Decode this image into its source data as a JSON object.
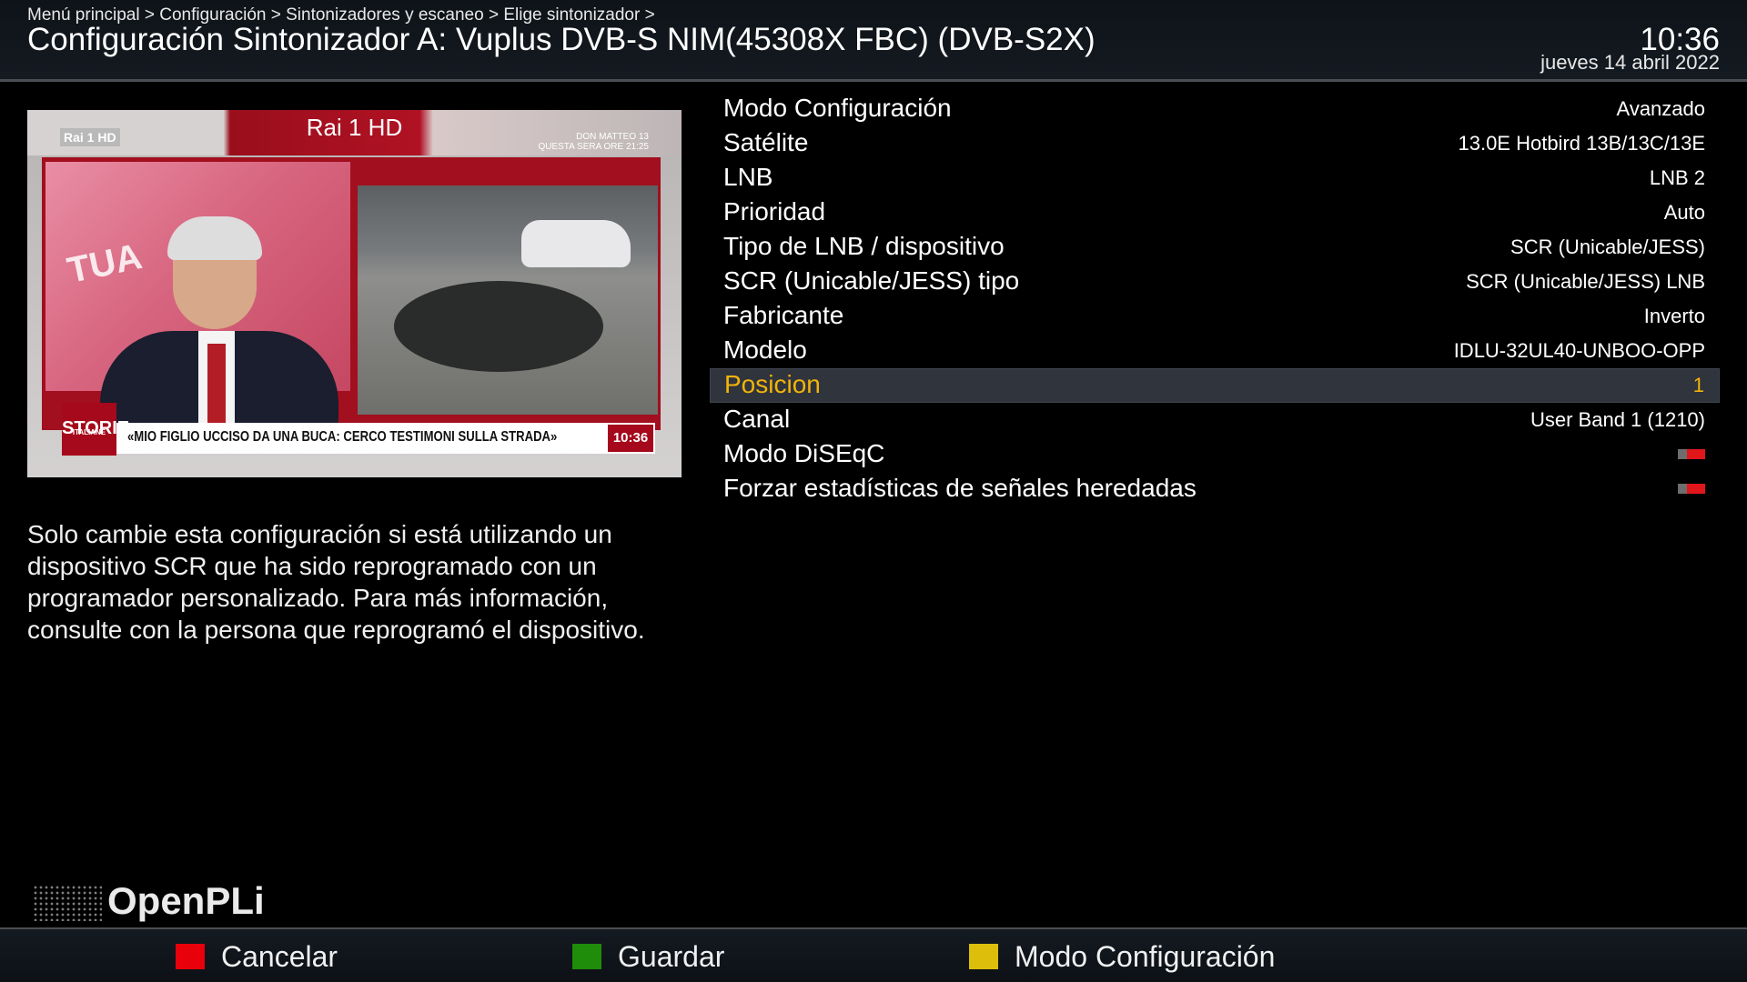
{
  "header": {
    "breadcrumb": "Menú principal > Configuración > Sintonizadores y escaneo > Elige sintonizador >",
    "title": "Configuración Sintonizador A: Vuplus DVB-S NIM(45308X FBC) (DVB-S2X)",
    "time": "10:36",
    "date": "jueves 14 abril 2022"
  },
  "preview": {
    "channel_name": "Rai 1 HD",
    "logo": "Rai 1 HD",
    "promo_line1": "DON MATTEO 13",
    "promo_line2": "QUESTA SERA ORE 21:25",
    "overlay_word": "TUA",
    "show_logo": "STORIE",
    "show_logo_sub": "ITALIANE",
    "ticker_text": "«MIO FIGLIO UCCISO DA UNA BUCA: CERCO TESTIMONI SULLA STRADA»",
    "ticker_time": "10:36"
  },
  "description": "Solo cambie esta configuración si está utilizando un dispositivo SCR que ha sido reprogramado con un programador personalizado. Para más información, consulte con la persona que reprogramó el dispositivo.",
  "settings": [
    {
      "label": "Modo Configuración",
      "value": "Avanzado"
    },
    {
      "label": "Satélite",
      "value": "13.0E Hotbird 13B/13C/13E"
    },
    {
      "label": "LNB",
      "value": "LNB 2"
    },
    {
      "label": "Prioridad",
      "value": "Auto"
    },
    {
      "label": "Tipo de LNB / dispositivo",
      "value": "SCR (Unicable/JESS)"
    },
    {
      "label": "SCR (Unicable/JESS) tipo",
      "value": "SCR (Unicable/JESS) LNB"
    },
    {
      "label": "Fabricante",
      "value": "Inverto"
    },
    {
      "label": "Modelo",
      "value": "IDLU-32UL40-UNBOO-OPP"
    },
    {
      "label": "Posicion",
      "value": "1",
      "selected": true
    },
    {
      "label": "Canal",
      "value": "User Band 1 (1210)"
    },
    {
      "label": "Modo DiSEqC",
      "toggle": "off"
    },
    {
      "label": "Forzar estadísticas de señales heredadas",
      "toggle": "off"
    }
  ],
  "brand": "OpenPLi",
  "footer": {
    "red_label": "Cancelar",
    "green_label": "Guardar",
    "yellow_label": "Modo Configuración",
    "colors": {
      "red": "#e8000b",
      "green": "#1f8c0a",
      "yellow": "#dcbe0b"
    }
  },
  "colors": {
    "selected_text": "#f2b40b",
    "selected_bg": "#30343c"
  }
}
